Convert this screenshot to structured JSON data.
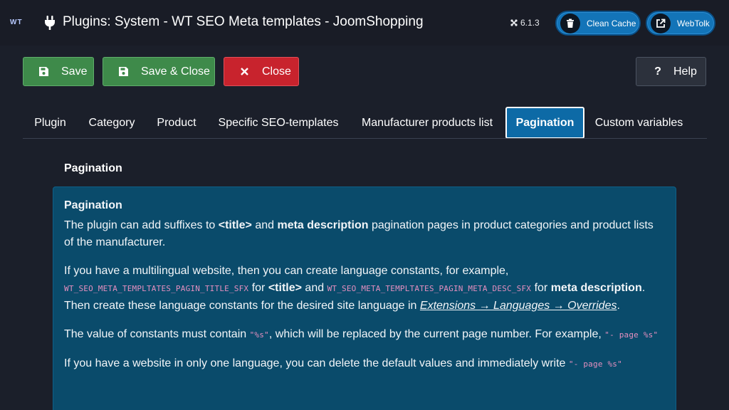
{
  "header": {
    "logo": "WT",
    "title": "Plugins: System - WT SEO Meta templates - JoomShopping",
    "version": "6.1.3",
    "clean_cache_label": "Clean Cache",
    "webtolk_label": "WebTolk"
  },
  "toolbar": {
    "save_label": "Save",
    "save_close_label": "Save & Close",
    "close_label": "Close",
    "help_label": "Help"
  },
  "tabs": [
    {
      "label": "Plugin",
      "active": false
    },
    {
      "label": "Category",
      "active": false
    },
    {
      "label": "Product",
      "active": false
    },
    {
      "label": "Specific SEO-templates",
      "active": false
    },
    {
      "label": "Manufacturer products list",
      "active": false
    },
    {
      "label": "Pagination",
      "active": true
    },
    {
      "label": "Custom variables",
      "active": false
    }
  ],
  "content": {
    "section_label": "Pagination",
    "box_title": "Pagination",
    "p1": {
      "t1": "The plugin can add suffixes to ",
      "b1": "<title>",
      "t2": " and ",
      "b2": "meta description",
      "t3": " pagination pages in product categories and product lists of the manufacturer."
    },
    "p2": {
      "t1": "If you have a multilingual website, then you can create language constants, for example, ",
      "code1": "WT_SEO_META_TEMPLTATES_PAGIN_TITLE_SFX",
      "t2": " for ",
      "b1": "<title>",
      "t3": " and ",
      "code2": "WT_SEO_META_TEMPLTATES_PAGIN_META_DESC_SFX",
      "t4": " for ",
      "b2": "meta description",
      "t5": ". Then create these language constants for the desired site language in ",
      "link": "Extensions → Languages → Overrides",
      "t6": "."
    },
    "p3": {
      "t1": "The value of constants must contain ",
      "code1": "\"%s\"",
      "t2": ", which will be replaced by the current page number. For example, ",
      "code2": "\"- page %s\""
    },
    "p4": {
      "t1": "If you have a website in only one language, you can delete the default values and immediately write ",
      "code1": "\"- page %s\""
    }
  }
}
